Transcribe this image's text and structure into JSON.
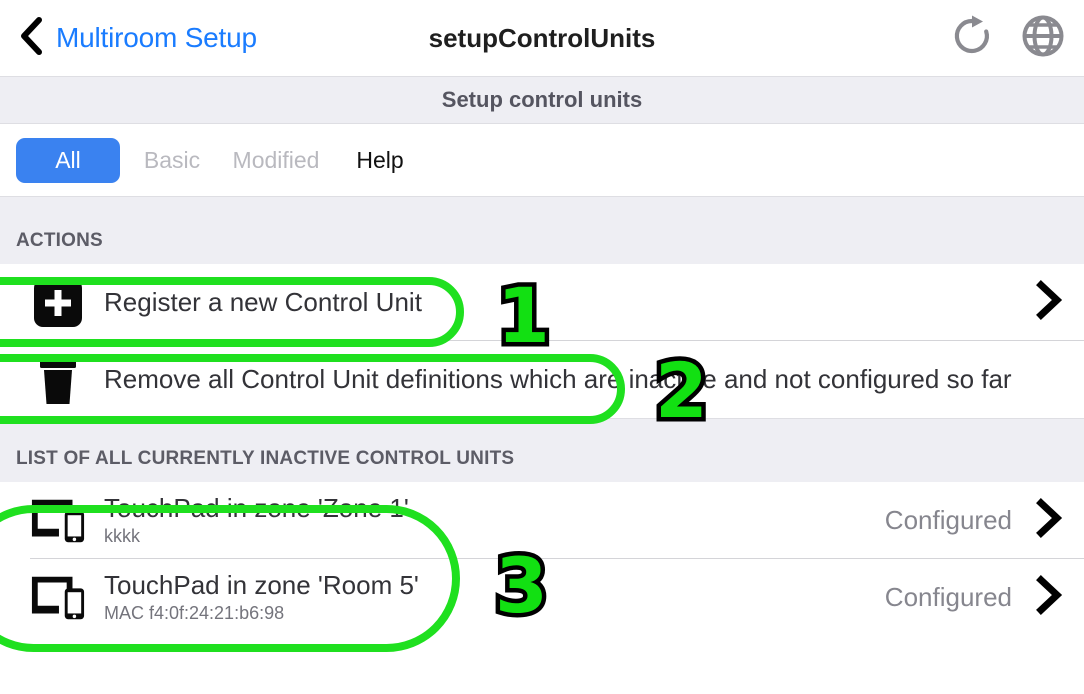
{
  "navbar": {
    "back_icon": "chevron-left-icon",
    "back_label": "Multiroom Setup",
    "title": "setupControlUnits",
    "refresh_icon": "refresh-icon",
    "globe_icon": "globe-icon"
  },
  "subheader": {
    "title": "Setup control units"
  },
  "tabs": [
    {
      "label": "All",
      "state": "active"
    },
    {
      "label": "Basic",
      "state": "disabled"
    },
    {
      "label": "Modified",
      "state": "disabled"
    },
    {
      "label": "Help",
      "state": "normal"
    }
  ],
  "sections": [
    {
      "header": "ACTIONS",
      "rows": [
        {
          "icon": "plus-square-icon",
          "title": "Register a new Control Unit",
          "subtitle": "",
          "value": "",
          "chevron": "chevron-right-icon"
        },
        {
          "icon": "trash-icon",
          "title": "Remove all Control Unit definitions which are inactive and not configured so far",
          "subtitle": "",
          "value": "",
          "chevron": ""
        }
      ]
    },
    {
      "header": "LIST OF ALL CURRENTLY INACTIVE CONTROL UNITS",
      "rows": [
        {
          "icon": "tablet-phone-icon",
          "title": "TouchPad in zone 'Zone 1'",
          "subtitle": "kkkk",
          "value": "Configured",
          "chevron": "chevron-right-icon"
        },
        {
          "icon": "tablet-phone-icon",
          "title": "TouchPad in zone 'Room 5'",
          "subtitle": "MAC f4:0f:24:21:b6:98",
          "value": "Configured",
          "chevron": "chevron-right-icon"
        }
      ]
    }
  ],
  "annotations": [
    {
      "number": "1"
    },
    {
      "number": "2"
    },
    {
      "number": "3"
    }
  ],
  "colors": {
    "accent_blue": "#3a82f0",
    "link_blue": "#1a7cff",
    "highlight_green": "#1fe01f",
    "section_bg": "#eeeef3"
  }
}
